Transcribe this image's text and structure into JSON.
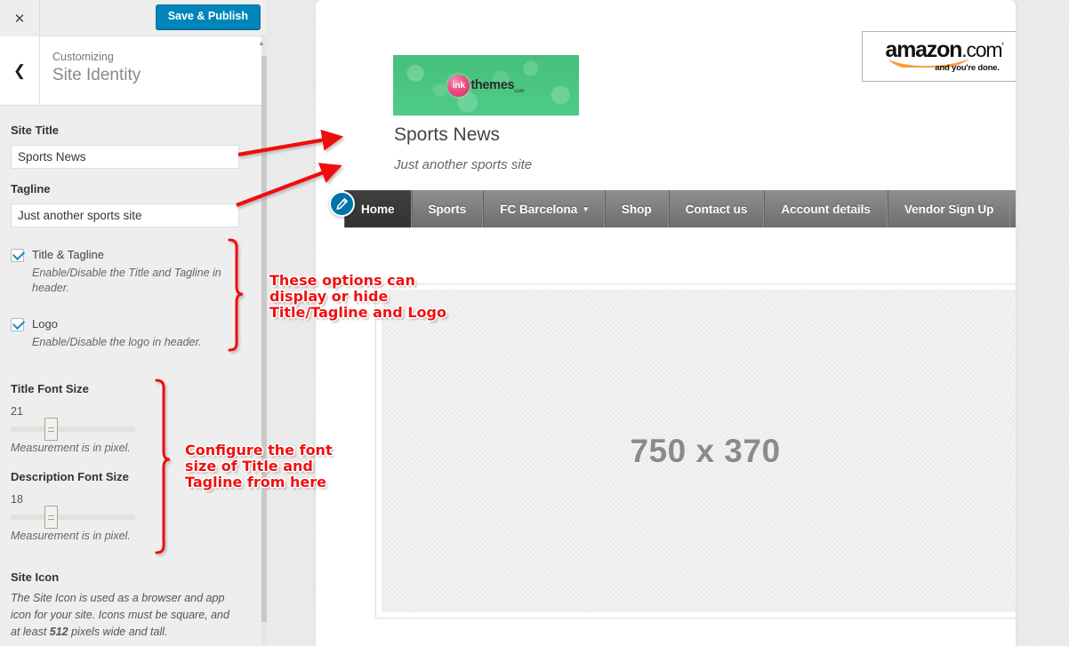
{
  "customizer": {
    "close_icon": "close-icon",
    "save_label": "Save & Publish",
    "back_icon": "chevron-left-icon",
    "eyebrow": "Customizing",
    "panel_title": "Site Identity",
    "fields": {
      "site_title_label": "Site Title",
      "site_title_value": "Sports News",
      "site_title_placeholder": "Site Title",
      "tagline_label": "Tagline",
      "tagline_value": "Just another sports site",
      "tagline_placeholder": "Tagline"
    },
    "checkboxes": [
      {
        "label": "Title & Tagline",
        "description": "Enable/Disable the Title and Tagline in header.",
        "checked": true
      },
      {
        "label": "Logo",
        "description": "Enable/Disable the logo in header.",
        "checked": true
      }
    ],
    "sliders": [
      {
        "label": "Title Font Size",
        "value": "21",
        "note": "Measurement is in pixel.",
        "percent": 27
      },
      {
        "label": "Description Font Size",
        "value": "18",
        "note": "Measurement is in pixel.",
        "percent": 27
      }
    ],
    "site_icon": {
      "label": "Site Icon",
      "description_part1": "The Site Icon is used as a browser and app icon for your site. Icons must be square, and at least ",
      "description_bold": "512",
      "description_part2": " pixels wide and tall."
    },
    "accent_color": "#0085ba"
  },
  "preview": {
    "logo": {
      "mark_text": "ink",
      "word": "themes",
      "tm": "com",
      "banner_color": "#4cc882",
      "bubble_color": "#ec4f84"
    },
    "amazon_banner": {
      "brand": "amazon",
      "domain": ".com",
      "tagline": "and you're done.",
      "swoosh_color": "#f79b34"
    },
    "site_title": "Sports News",
    "site_description": "Just another sports site",
    "edit_icon": "pencil-edit-icon",
    "nav_items": [
      {
        "label": "Home",
        "active": true,
        "has_caret": false
      },
      {
        "label": "Sports",
        "active": false,
        "has_caret": false
      },
      {
        "label": "FC Barcelona",
        "active": false,
        "has_caret": true
      },
      {
        "label": "Shop",
        "active": false,
        "has_caret": false
      },
      {
        "label": "Contact us",
        "active": false,
        "has_caret": false
      },
      {
        "label": "Account details",
        "active": false,
        "has_caret": false
      },
      {
        "label": "Vendor Sign Up",
        "active": false,
        "has_caret": false
      }
    ],
    "hero_placeholder": "750 x 370"
  },
  "annotations": {
    "options_note": "These options can\ndisplay or hide\nTitle/Tagline and Logo",
    "fontsize_note": "Configure the font\nsize of Title and\nTagline from here",
    "color": "#f01010"
  }
}
